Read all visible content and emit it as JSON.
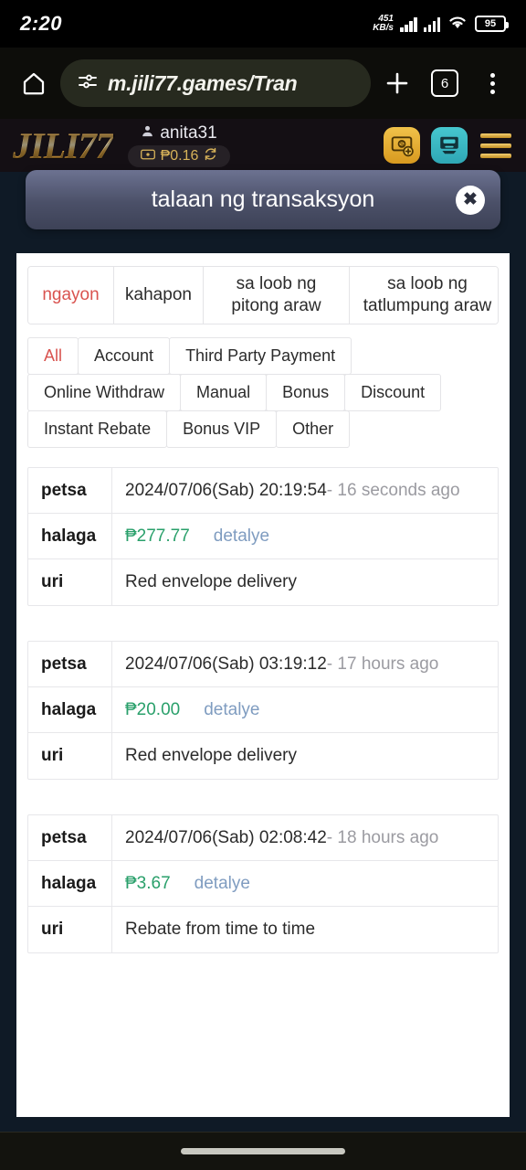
{
  "status_bar": {
    "time": "2:20",
    "net_speed_value": "451",
    "net_speed_unit": "KB/s",
    "battery_level": "95"
  },
  "browser": {
    "url": "m.jili77.games/Tran",
    "tab_count": "6",
    "home_icon": "home-icon",
    "tune_icon": "page-info-icon",
    "new_tab_icon": "plus-icon",
    "menu_icon": "overflow-menu-icon"
  },
  "site_header": {
    "logo_text": "JILI77",
    "username": "anita31",
    "balance": "₱0.16",
    "deposit_icon": "deposit-money-icon",
    "withdraw_icon": "atm-withdraw-icon",
    "menu_icon": "hamburger-menu-icon",
    "refresh_icon": "refresh-icon",
    "wallet_icon": "wallet-icon",
    "user_icon": "user-icon"
  },
  "modal": {
    "title": "talaan ng transaksyon",
    "close_label": "✖"
  },
  "date_tabs": [
    {
      "label": "ngayon",
      "active": true
    },
    {
      "label": "kahapon",
      "active": false
    },
    {
      "label": "sa loob ng pitong araw",
      "active": false
    },
    {
      "label": "sa loob ng tatlumpung araw",
      "active": false
    }
  ],
  "category_chips": [
    {
      "label": "All",
      "active": true
    },
    {
      "label": "Account",
      "active": false
    },
    {
      "label": "Third Party Payment",
      "active": false
    },
    {
      "label": "Online Withdraw",
      "active": false
    },
    {
      "label": "Manual",
      "active": false
    },
    {
      "label": "Bonus",
      "active": false
    },
    {
      "label": "Discount",
      "active": false
    },
    {
      "label": "Instant Rebate",
      "active": false
    },
    {
      "label": "Bonus VIP",
      "active": false
    },
    {
      "label": "Other",
      "active": false
    }
  ],
  "row_labels": {
    "date": "petsa",
    "amount": "halaga",
    "type": "uri"
  },
  "detail_link": "detalye",
  "records": [
    {
      "date": "2024/07/06(Sab) 20:19:54",
      "relative": "- 16 seconds ago",
      "amount": "₱277.77",
      "type": "Red envelope delivery"
    },
    {
      "date": "2024/07/06(Sab) 03:19:12",
      "relative": "- 17 hours ago",
      "amount": "₱20.00",
      "type": "Red envelope delivery"
    },
    {
      "date": "2024/07/06(Sab) 02:08:42",
      "relative": "- 18 hours ago",
      "amount": "₱3.67",
      "type": "Rebate from time to time"
    }
  ],
  "colors": {
    "page_bg": "#0f1a26",
    "accent_red": "#d9534f",
    "amount_green": "#2aa06b",
    "link_blue": "#7f9cc0",
    "gold": "#d7b259",
    "teal": "#46c7cf"
  }
}
